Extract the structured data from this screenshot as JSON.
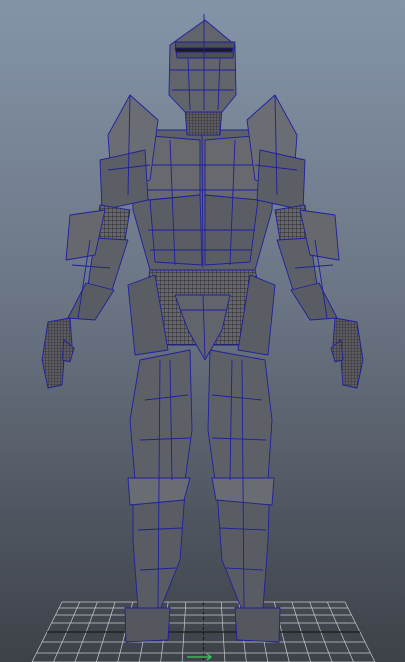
{
  "viewport": {
    "view_name": "front",
    "background_top": "#8494a8",
    "background_bottom": "#3d4148"
  },
  "model": {
    "name": "armored-knight",
    "shade_color": "#5e6068",
    "dark_shade": "#4a4c52",
    "light_shade": "#70727a",
    "wire_color": "#1f1f9e",
    "mesh_color": "#1a1a1a"
  },
  "grid": {
    "line_color": "#c7c9cc",
    "center_line_color": "#1b1b1b"
  },
  "axis": {
    "color": "#2fd35a"
  }
}
